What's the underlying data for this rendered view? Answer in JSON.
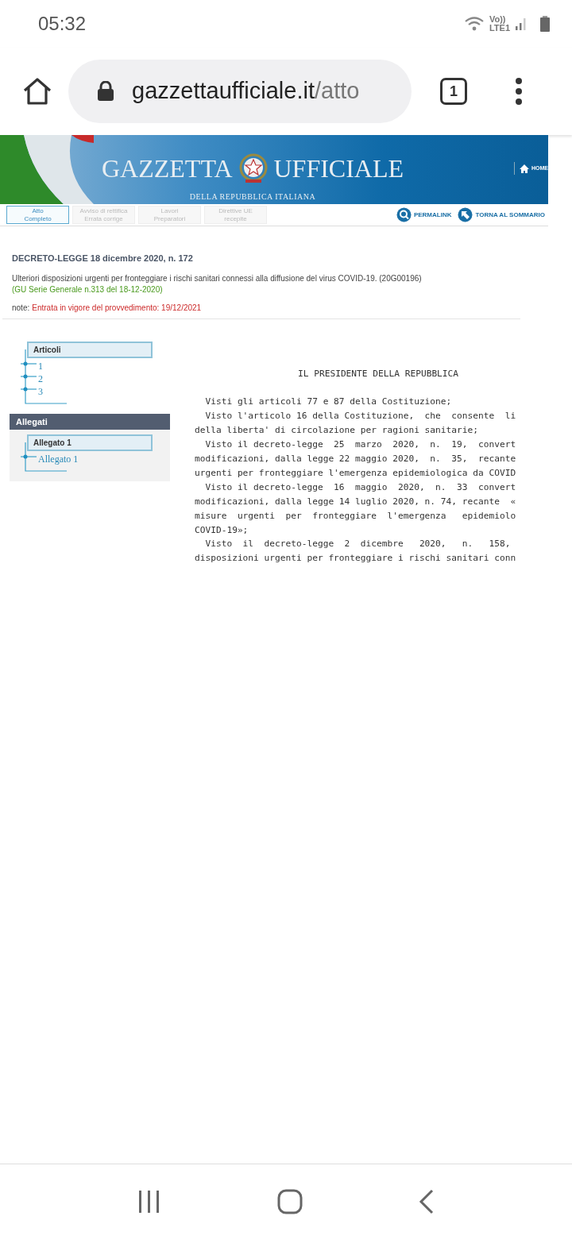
{
  "status_bar": {
    "time": "05:32",
    "volte": "Vo))",
    "network": "LTE1"
  },
  "browser": {
    "host": "gazzettaufficiale.it",
    "path": "/atto",
    "tab_count": "1"
  },
  "banner": {
    "title_left": "GAZZETTA",
    "title_right": "UFFICIALE",
    "subtitle": "DELLA REPUBBLICA ITALIANA",
    "home": "HOME"
  },
  "tabs": [
    {
      "lines": [
        "Atto",
        "Completo"
      ],
      "selected": true,
      "disabled": false
    },
    {
      "lines": [
        "Avviso di rettifica",
        "Errata corrige"
      ],
      "selected": false,
      "disabled": true
    },
    {
      "lines": [
        "Lavori",
        "Preparatori"
      ],
      "selected": false,
      "disabled": true
    },
    {
      "lines": [
        "Direttive UE",
        "recepite"
      ],
      "selected": false,
      "disabled": true
    }
  ],
  "actions": [
    {
      "label": "PERMALINK",
      "kind": "search"
    },
    {
      "label": "TORNA AL SOMMARIO",
      "kind": "back"
    }
  ],
  "document": {
    "title": "DECRETO-LEGGE 18 dicembre 2020, n. 172",
    "description": "Ulteriori disposizioni urgenti per fronteggiare i rischi sanitari connessi alla diffusione del virus COVID-19. (20G00196)",
    "gazette": "(GU Serie Generale n.313 del 18-12-2020)",
    "note_label": "note:",
    "note": "Entrata in vigore del provvedimento: 19/12/2021"
  },
  "articles": {
    "heading": "Articoli",
    "items": [
      "1",
      "2",
      "3"
    ]
  },
  "attachments": {
    "header": "Allegati",
    "heading": "Allegato 1",
    "items": [
      "Allegato 1"
    ]
  },
  "body": {
    "heading": "IL PRESIDENTE DELLA REPUBBLICA",
    "lines": [
      "  Visti gli articoli 77 e 87 della Costituzione;",
      "  Visto l'articolo 16 della Costituzione,  che  consente  li",
      "della liberta' di circolazione per ragioni sanitarie;",
      "  Visto il decreto-legge  25  marzo  2020,  n.  19,  convert",
      "modificazioni, dalla legge 22 maggio 2020,  n.  35,  recante",
      "urgenti per fronteggiare l'emergenza epidemiologica da COVID",
      "  Visto il decreto-legge  16  maggio  2020,  n.  33  convert",
      "modificazioni, dalla legge 14 luglio 2020, n. 74, recante  «",
      "misure  urgenti  per  fronteggiare  l'emergenza   epidemiolo",
      "COVID-19»;",
      "  Visto  il  decreto-legge  2  dicembre   2020,   n.   158,",
      "disposizioni urgenti per fronteggiare i rischi sanitari conn"
    ]
  }
}
